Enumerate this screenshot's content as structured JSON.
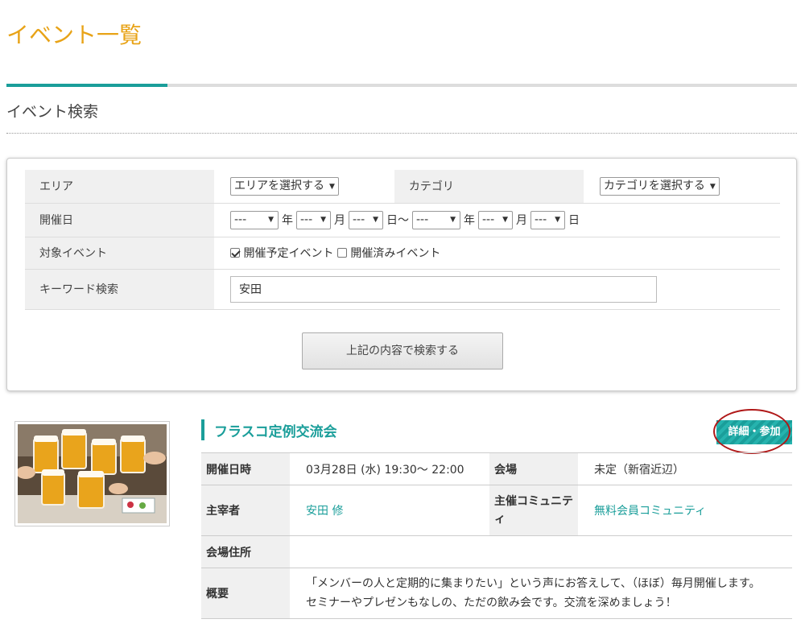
{
  "page": {
    "title": "イベント一覧",
    "section_title": "イベント検索"
  },
  "search": {
    "area_label": "エリア",
    "area_select": "エリアを選択する",
    "category_label": "カテゴリ",
    "category_select": "カテゴリを選択する",
    "date_label": "開催日",
    "date_placeholder": "---",
    "year_unit": "年",
    "month_unit": "月",
    "day_unit": "日",
    "range_sep": "日〜",
    "target_label": "対象イベント",
    "upcoming_label": "開催予定イベント",
    "upcoming_checked": true,
    "past_label": "開催済みイベント",
    "past_checked": false,
    "keyword_label": "キーワード検索",
    "keyword_value": "安田",
    "submit_label": "上記の内容で検索する"
  },
  "event": {
    "image_icon": "beer-toast-photo",
    "title": "フラスコ定例交流会",
    "detail_button": "詳細・参加",
    "date_label": "開催日時",
    "date_value": "03月28日 (水) 19:30〜 22:00",
    "venue_label": "会場",
    "venue_value": "未定（新宿近辺）",
    "organizer_label": "主宰者",
    "organizer_value": "安田 修",
    "community_label": "主催コミュニティ",
    "community_value": "無料会員コミュニティ",
    "address_label": "会場住所",
    "address_value": "",
    "summary_label": "概要",
    "summary_line1": "「メンバーの人と定期的に集まりたい」という声にお答えして、（ほぼ）毎月開催します。",
    "summary_line2": "セミナーやプレゼンもなしの、ただの飲み会です。交流を深めましょう！"
  },
  "colors": {
    "title_orange": "#e8a317",
    "accent_teal": "#1a9e9a",
    "annotation_red": "#b01818"
  }
}
